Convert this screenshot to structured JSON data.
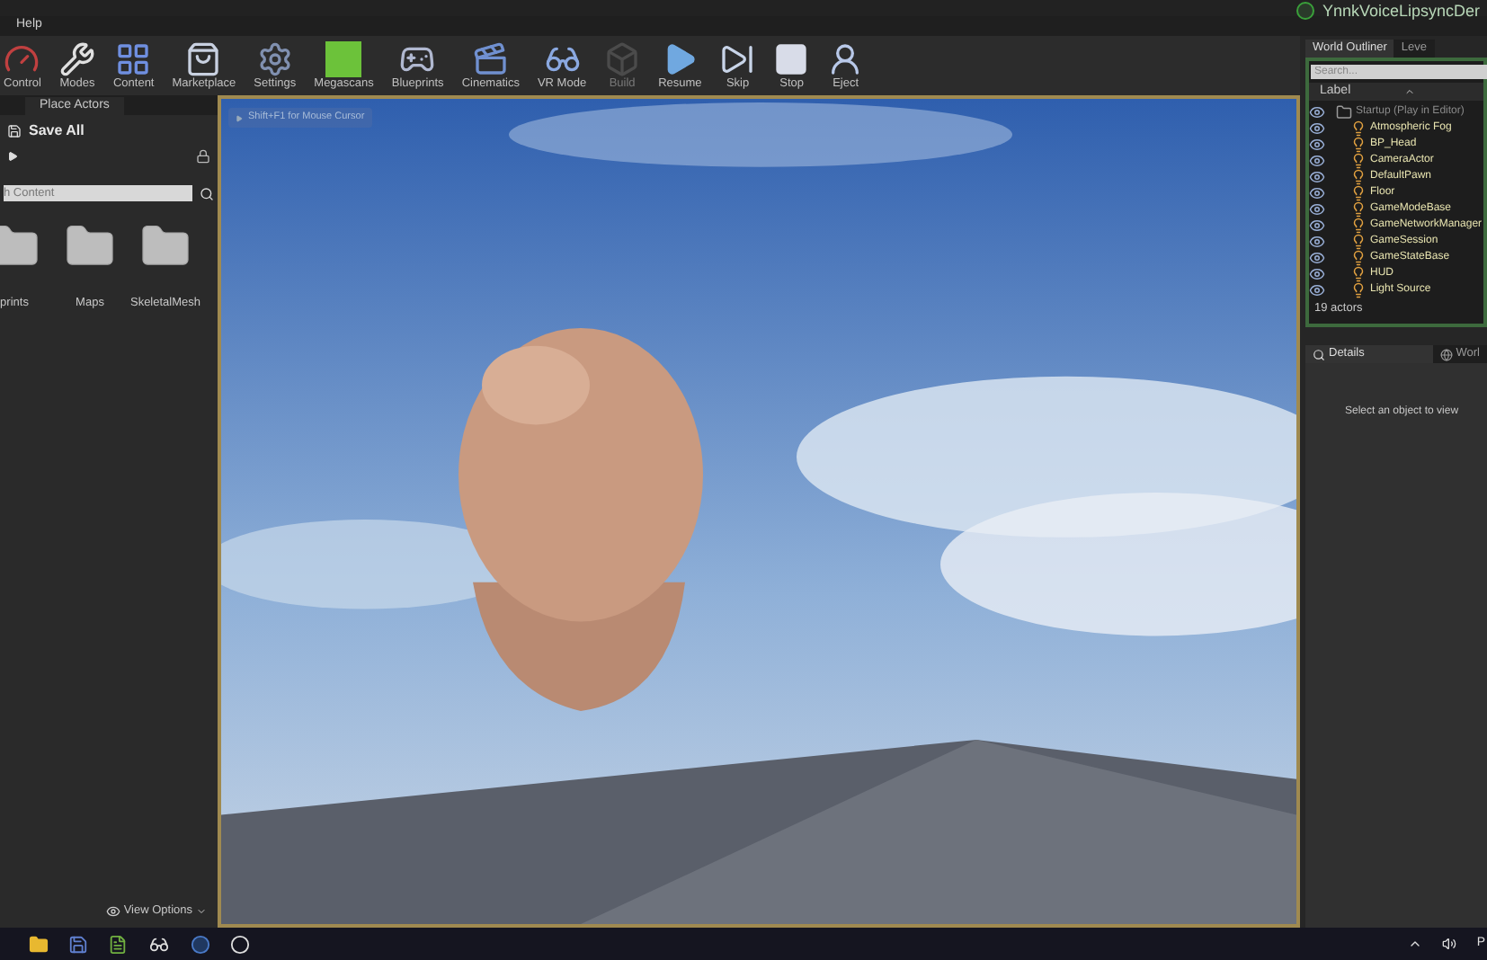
{
  "window": {
    "title": "YnnkVoiceLipsyncDer"
  },
  "menu": [
    "Help"
  ],
  "toolbar": [
    {
      "label": "Control",
      "kind": "control",
      "disabled": false
    },
    {
      "label": "Modes",
      "kind": "modes",
      "disabled": false
    },
    {
      "label": "Content",
      "kind": "content",
      "disabled": false
    },
    {
      "label": "Marketplace",
      "kind": "market",
      "disabled": false
    },
    {
      "label": "Settings",
      "kind": "settings",
      "disabled": false
    },
    {
      "label": "Megascans",
      "kind": "megascans",
      "disabled": false
    },
    {
      "label": "Blueprints",
      "kind": "blueprints",
      "disabled": false
    },
    {
      "label": "Cinematics",
      "kind": "cinematics",
      "disabled": false
    },
    {
      "label": "VR Mode",
      "kind": "vr",
      "disabled": false
    },
    {
      "label": "Build",
      "kind": "build",
      "disabled": true
    },
    {
      "label": "Resume",
      "kind": "resume",
      "disabled": false
    },
    {
      "label": "Skip",
      "kind": "skip",
      "disabled": false
    },
    {
      "label": "Stop",
      "kind": "stop",
      "disabled": false
    },
    {
      "label": "Eject",
      "kind": "eject",
      "disabled": false
    }
  ],
  "left_panel": {
    "tab": "Place Actors",
    "save_all": "Save All",
    "search": {
      "placeholder": "h Content"
    },
    "folders": [
      "prints",
      "Maps",
      "SkeletalMesh"
    ],
    "view_options": "View Options"
  },
  "viewport": {
    "hint": "Shift+F1 for Mouse Cursor"
  },
  "world_outliner": {
    "tabs": [
      {
        "label": "World Outliner",
        "selected": true
      },
      {
        "label": "Leve",
        "selected": false
      }
    ],
    "search": {
      "placeholder": "Search..."
    },
    "column": "Label",
    "tree": [
      {
        "label": "Startup (Play in Editor)",
        "children": [
          {
            "label": "Atmospheric Fog"
          },
          {
            "label": "BP_Head"
          },
          {
            "label": "CameraActor"
          },
          {
            "label": "DefaultPawn"
          },
          {
            "label": "Floor"
          },
          {
            "label": "GameModeBase"
          },
          {
            "label": "GameNetworkManager"
          },
          {
            "label": "GameSession"
          },
          {
            "label": "GameStateBase"
          },
          {
            "label": "HUD"
          },
          {
            "label": "Light Source"
          }
        ]
      }
    ],
    "count": "19 actors"
  },
  "details": {
    "tabs": [
      {
        "label": "Details",
        "selected": true
      },
      {
        "label": "Worl",
        "selected": false
      }
    ],
    "empty": "Select an object to view"
  },
  "taskbar": {
    "language": "Р"
  }
}
